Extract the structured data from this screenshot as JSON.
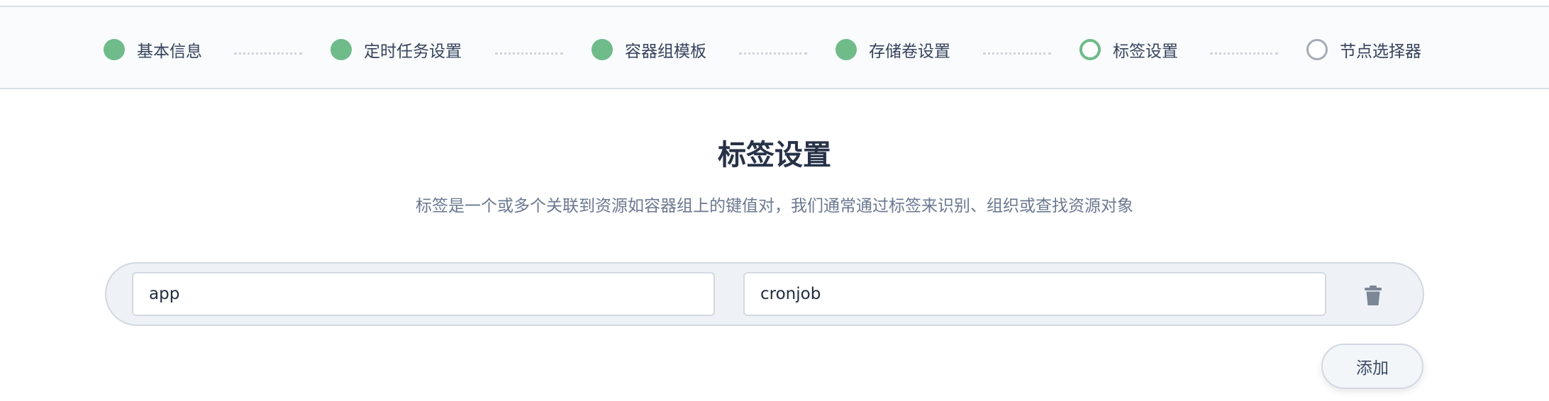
{
  "steps": [
    {
      "label": "基本信息",
      "status": "done"
    },
    {
      "label": "定时任务设置",
      "status": "done"
    },
    {
      "label": "容器组模板",
      "status": "done"
    },
    {
      "label": "存储卷设置",
      "status": "done"
    },
    {
      "label": "标签设置",
      "status": "current"
    },
    {
      "label": "节点选择器",
      "status": "todo"
    }
  ],
  "page": {
    "title": "标签设置",
    "description": "标签是一个或多个关联到资源如容器组上的键值对，我们通常通过标签来识别、组织或查找资源对象"
  },
  "labels": [
    {
      "key": "app",
      "value": "cronjob",
      "delete_icon": "trash-icon"
    }
  ],
  "actions": {
    "add_label": "添加"
  },
  "colors": {
    "step_done": "#6fbb8a",
    "step_todo": "#a4acb8",
    "title": "#273248",
    "description": "#6b7890",
    "row_background": "#eef2f6"
  }
}
